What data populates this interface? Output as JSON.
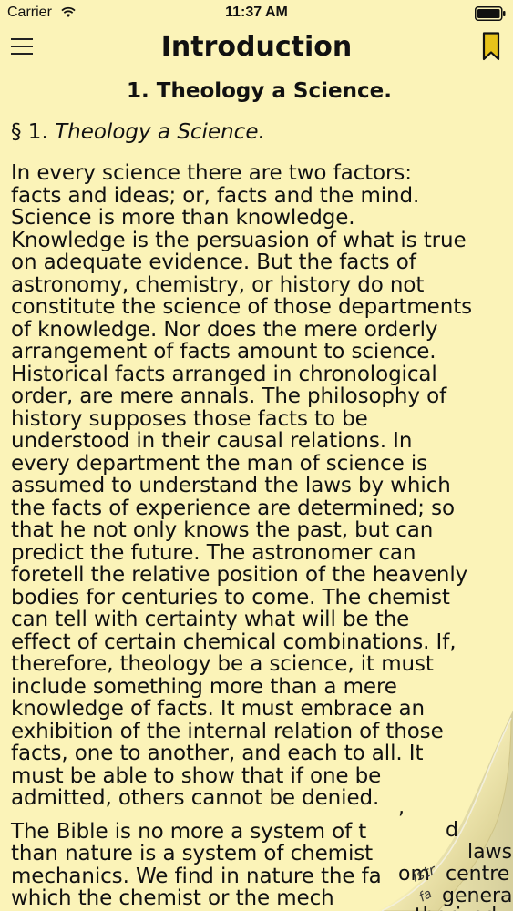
{
  "status_bar": {
    "carrier": "Carrier",
    "time": "11:37 AM"
  },
  "nav": {
    "title": "Introduction",
    "menu_icon": "hamburger-menu-icon",
    "bookmark_icon": "bookmark-icon",
    "accent_color": "#e7c31a"
  },
  "content": {
    "section_heading": "1. Theology a Science.",
    "paragraph_mark": "§ 1.",
    "paragraph_title": "Theology a Science.",
    "paragraph1_lines": [
      "In every science there are two factors:",
      "facts and ideas; or, facts and the mind.",
      "Science is more than knowledge.",
      "Knowledge is the persuasion of what is true",
      "on adequate evidence. But the facts of",
      "astronomy, chemistry, or history do not",
      "constitute the science of those departments",
      "of knowledge. Nor does the mere orderly",
      "arrangement of facts amount to science.",
      "Historical facts arranged in chronological",
      "order, are mere annals. The philosophy of",
      "history supposes those facts to be",
      "understood in their causal relations. In",
      "every department the man of science is",
      "assumed to understand the laws by which",
      "the facts of experience are determined; so",
      "that he not only knows the past, but can",
      "predict the future. The astronomer can",
      "foretell the relative position of the heavenly",
      "bodies for centuries to come. The chemist",
      "can tell with certainty what will be the",
      "effect of certain chemical combinations. If,",
      "therefore, theology be a science, it must",
      "include something more than a mere",
      "knowledge of facts. It must embrace an",
      "exhibition of the internal relation of those",
      "facts, one to another, and each to all. It",
      "must be able to show that if one be",
      "admitted, others cannot be denied."
    ],
    "paragraph2_lines": [
      "The Bible is no more a system of t",
      "than nature is a system of chemist",
      "mechanics. We find in nature the fa",
      "which the chemist or the mech"
    ],
    "curl_fragments": {
      "line28_tail": ",",
      "line29_tail": "d",
      "line30_tail": "laws",
      "line31_mid": "om",
      "line31_back": "istr",
      "line31_tail": "centre",
      "line32_back": "fa",
      "line32_tail": "general",
      "line33_tail": "uthorized"
    }
  }
}
